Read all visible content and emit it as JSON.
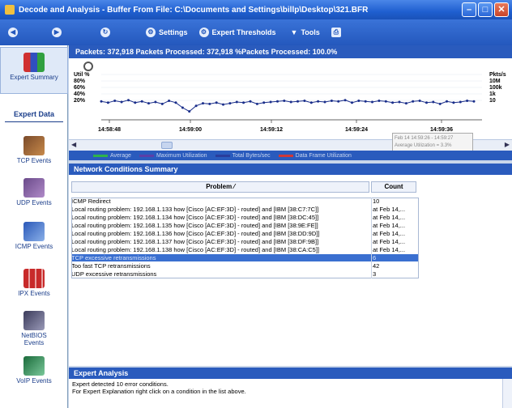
{
  "window": {
    "title": "Decode and Analysis - Buffer From File:  C:\\Documents and Settings\\billp\\Desktop\\321.BFR"
  },
  "toolbar": {
    "settings_label": "Settings",
    "expert_thresholds_label": "Expert Thresholds",
    "tools_label": "Tools"
  },
  "stats": {
    "text": "Packets: 372,918    Packets Processed: 372,918    %Packets Processed: 100.0%"
  },
  "sidebar": {
    "items": [
      {
        "label": "Expert Summary",
        "icon": "expert-summary-icon"
      },
      {
        "label": "Expert Data",
        "icon": ""
      },
      {
        "label": "TCP Events",
        "icon": "tcp-events-icon"
      },
      {
        "label": "UDP Events",
        "icon": "udp-events-icon"
      },
      {
        "label": "ICMP Events",
        "icon": "icmp-events-icon"
      },
      {
        "label": "IPX Events",
        "icon": "ipx-events-icon"
      },
      {
        "label": "NetBIOS Events",
        "icon": "netbios-events-icon"
      },
      {
        "label": "VoIP Events",
        "icon": "voip-events-icon"
      }
    ]
  },
  "chart": {
    "left_ticks": [
      "Util %",
      "80%",
      "60%",
      "40%",
      "20%"
    ],
    "right_ticks": [
      "Pkts/s",
      "10M",
      "100k",
      "1k",
      "10"
    ],
    "time_ticks": [
      "14:58:48",
      "14:59:00",
      "14:59:12",
      "14:59:24",
      "14:59:36"
    ],
    "series_color": "#1a2e8a",
    "y_values": [
      40,
      38,
      41,
      39,
      42,
      38,
      40,
      37,
      39,
      36,
      41,
      38,
      30,
      24,
      33,
      37,
      36,
      38,
      35,
      37,
      39,
      38,
      40,
      36,
      38,
      39,
      40,
      41,
      39,
      40,
      41,
      38,
      40,
      39,
      41,
      40,
      42,
      38,
      41,
      40,
      39,
      41,
      40,
      38,
      39,
      37,
      40,
      41,
      38,
      39,
      36,
      40,
      38,
      39,
      41,
      40
    ]
  },
  "tooltip": {
    "line1": "Feb 14 14:59:26 - 14:59:27",
    "line2": "Average Utilization = 3.3%"
  },
  "legend": {
    "items": [
      {
        "label": "Average",
        "color": "#2fb34a"
      },
      {
        "label": "Maximum Utilization",
        "color": "#5b3fa8"
      },
      {
        "label": "Total Bytes/sec",
        "color": "#2a3d9c"
      },
      {
        "label": "Data Frame Utilization",
        "color": "#cf3838"
      }
    ]
  },
  "network_summary": {
    "title": "Network Conditions Summary",
    "col_problem": "Problem",
    "col_count": "Count",
    "rows": [
      {
        "problem": "ICMP Redirect",
        "count": "10"
      },
      {
        "problem": "Local routing problem: 192.168.1.133 how [Cisco [AC:EF:3D] - routed] and [IBM [38:C7:7C]]",
        "count": "at Feb 14,..."
      },
      {
        "problem": "Local routing problem: 192.168.1.134 how [Cisco [AC:EF:3D] - routed] and [IBM [38:DC:45]]",
        "count": "at Feb 14,..."
      },
      {
        "problem": "Local routing problem: 192.168.1.135 how [Cisco [AC:EF:3D] - routed] and [IBM [38:9E:FE]]",
        "count": "at Feb 14,..."
      },
      {
        "problem": "Local routing problem: 192.168.1.136 how [Cisco [AC:EF:3D] - routed] and [IBM [38:DD:9D]]",
        "count": "at Feb 14,..."
      },
      {
        "problem": "Local routing problem: 192.168.1.137 how [Cisco [AC:EF:3D] - routed] and [IBM [38:DF:9B]]",
        "count": "at Feb 14,..."
      },
      {
        "problem": "Local routing problem: 192.168.1.138 how [Cisco [AC:EF:3D] - routed] and [IBM [38:CA:C5]]",
        "count": "at Feb 14,..."
      },
      {
        "problem": "TCP excessive retransmissions",
        "count": "6"
      },
      {
        "problem": "Too fast TCP retransmissions",
        "count": "42"
      },
      {
        "problem": "UDP excessive retransmissions",
        "count": "3"
      }
    ]
  },
  "expert_analysis": {
    "title": "Expert Analysis",
    "line1": "Expert detected 10 error conditions.",
    "line2": "For Expert Explanation right click on a condition in the list above."
  }
}
